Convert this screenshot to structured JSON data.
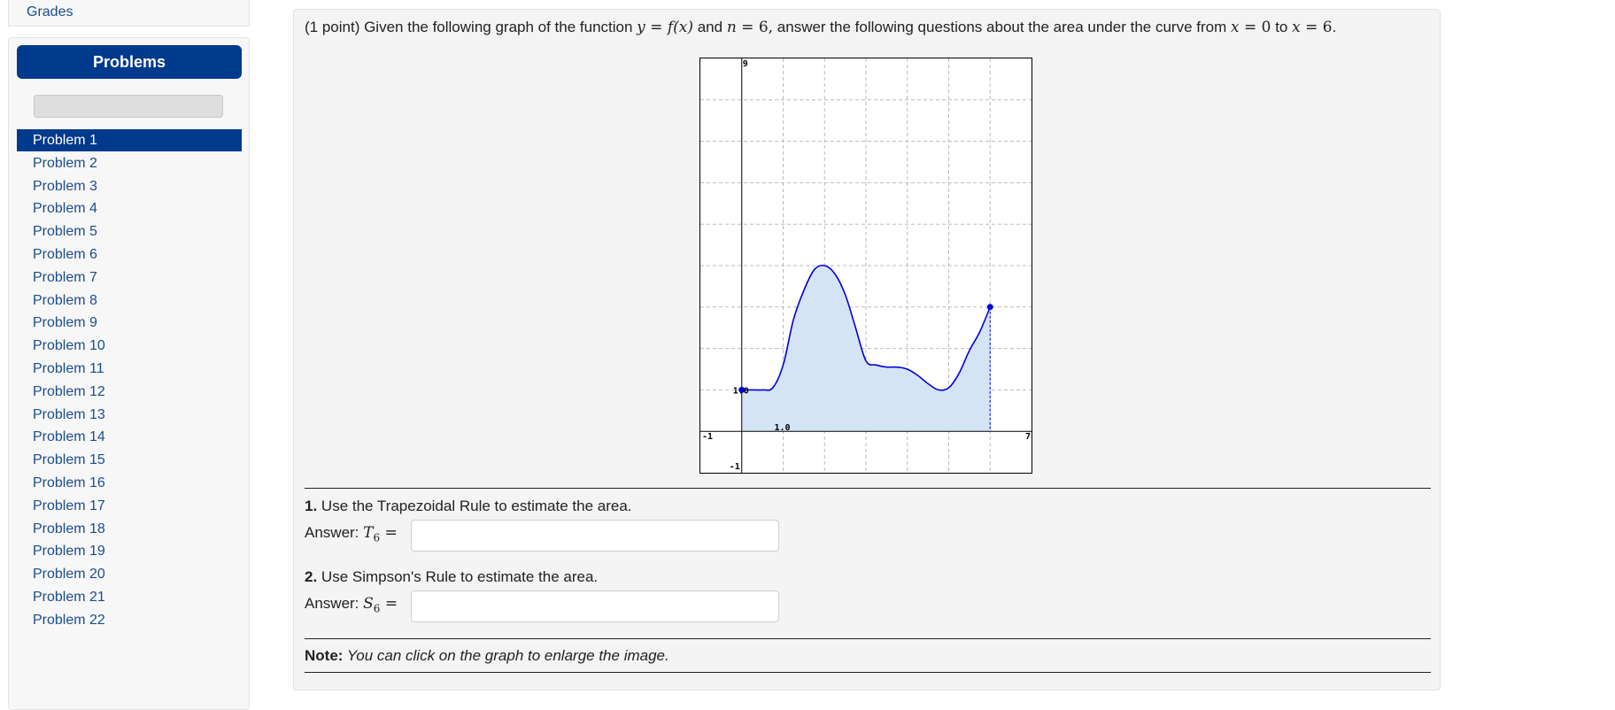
{
  "sidebar": {
    "grades_label": "Grades",
    "problems_header": "Problems",
    "problems": [
      "Problem 1",
      "Problem 2",
      "Problem 3",
      "Problem 4",
      "Problem 5",
      "Problem 6",
      "Problem 7",
      "Problem 8",
      "Problem 9",
      "Problem 10",
      "Problem 11",
      "Problem 12",
      "Problem 13",
      "Problem 14",
      "Problem 15",
      "Problem 16",
      "Problem 17",
      "Problem 18",
      "Problem 19",
      "Problem 20",
      "Problem 21",
      "Problem 22"
    ],
    "active_index": 0
  },
  "question": {
    "prefix": "(1 point) Given the following graph of the function ",
    "y": "y",
    "eq1": " = ",
    "fx": "f(x)",
    "and": " and ",
    "n": "n",
    "eq2": " = ",
    "n_val": "6,",
    "rest": " answer the following questions about the area under the curve from ",
    "x1": "x",
    "eq3": " = ",
    "x1_val": "0",
    "to": " to ",
    "x2": "x",
    "eq4": " = ",
    "x2_val": "6",
    "end": "."
  },
  "graph": {
    "tick_y_top": "9",
    "tick_y_bottom": "-1",
    "tick_x_left": "-1",
    "tick_x_right": "7",
    "tick_x_one": "1.0",
    "tick_y_one": "1.0",
    "curve_color": "#0000dd",
    "fill_color": "#d4e4f4"
  },
  "chart_data": {
    "type": "line",
    "x": [
      0,
      0.25,
      0.5,
      0.75,
      1.0,
      1.25,
      1.5,
      1.75,
      2.0,
      2.25,
      2.5,
      2.75,
      3.0,
      3.25,
      3.5,
      3.75,
      4.0,
      4.25,
      4.5,
      4.75,
      5.0,
      5.25,
      5.5,
      5.75,
      6.0
    ],
    "series": [
      {
        "values": [
          1.0,
          1.0,
          1.0,
          1.05,
          1.6,
          2.7,
          3.4,
          3.9,
          4.0,
          3.8,
          3.3,
          2.5,
          1.7,
          1.6,
          1.55,
          1.55,
          1.5,
          1.35,
          1.15,
          1.0,
          1.05,
          1.4,
          1.95,
          2.4,
          3.0
        ]
      }
    ],
    "xlim": [
      -1,
      7
    ],
    "ylim": [
      -1,
      9
    ],
    "shaded": [
      0,
      6
    ],
    "grid": true
  },
  "q1": {
    "number": "1.",
    "text": " Use the Trapezoidal Rule to estimate the area.",
    "answer_label": "Answer: ",
    "symbol": "T",
    "sub": "6",
    "eq": " = "
  },
  "q2": {
    "number": "2.",
    "text": " Use Simpson's Rule to estimate the area.",
    "answer_label": "Answer: ",
    "symbol": "S",
    "sub": "6",
    "eq": " = "
  },
  "note": {
    "label": "Note:",
    "text": " You can click on the graph to enlarge the image."
  }
}
